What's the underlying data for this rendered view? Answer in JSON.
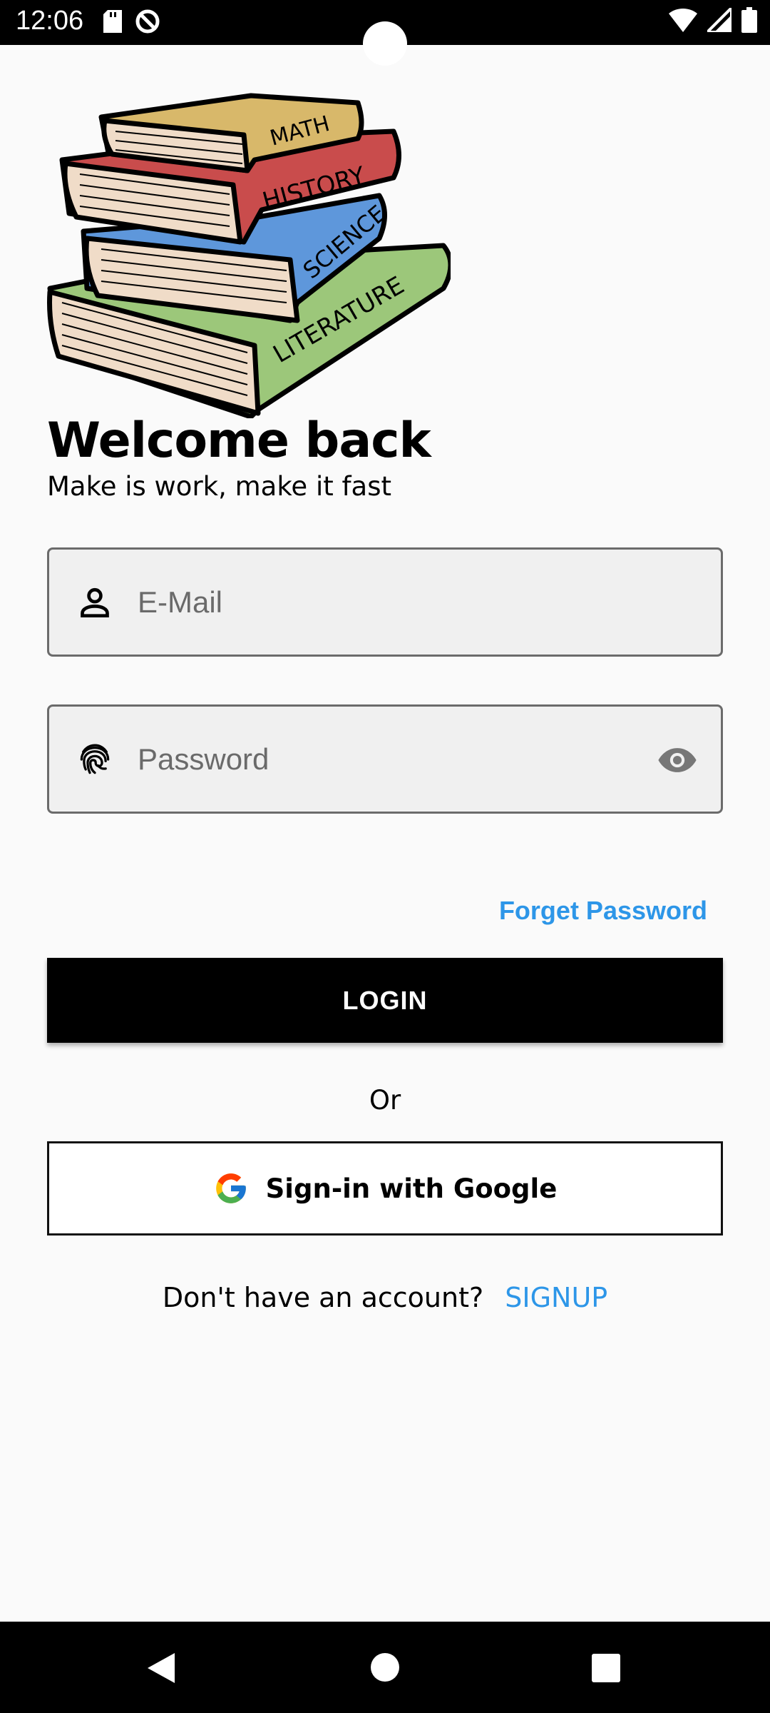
{
  "status_bar": {
    "time": "12:06"
  },
  "book_spines": [
    "MATH",
    "HISTORY",
    "SCIENCE",
    "LITERATURE"
  ],
  "header": {
    "title": "Welcome back",
    "subtitle": "Make is work, make it fast"
  },
  "form": {
    "email_placeholder": "E-Mail",
    "password_placeholder": "Password",
    "forget_password_label": "Forget Password",
    "login_label": "LOGIN",
    "or_label": "Or",
    "google_label": "Sign-in with Google"
  },
  "footer": {
    "no_account_text": "Don't have an account?",
    "signup_label": "SIGNUP"
  },
  "colors": {
    "accent": "#2d96e8",
    "math_book": "#d8b86a",
    "history_book": "#c94c4c",
    "science_book": "#5e97db",
    "literature_book": "#9cc77a"
  },
  "icons": [
    "sd-card-icon",
    "at-sign-icon",
    "wifi-icon",
    "signal-icon",
    "battery-icon",
    "person-icon",
    "fingerprint-icon",
    "eye-icon",
    "google-icon",
    "back-icon",
    "home-icon",
    "recents-icon"
  ]
}
